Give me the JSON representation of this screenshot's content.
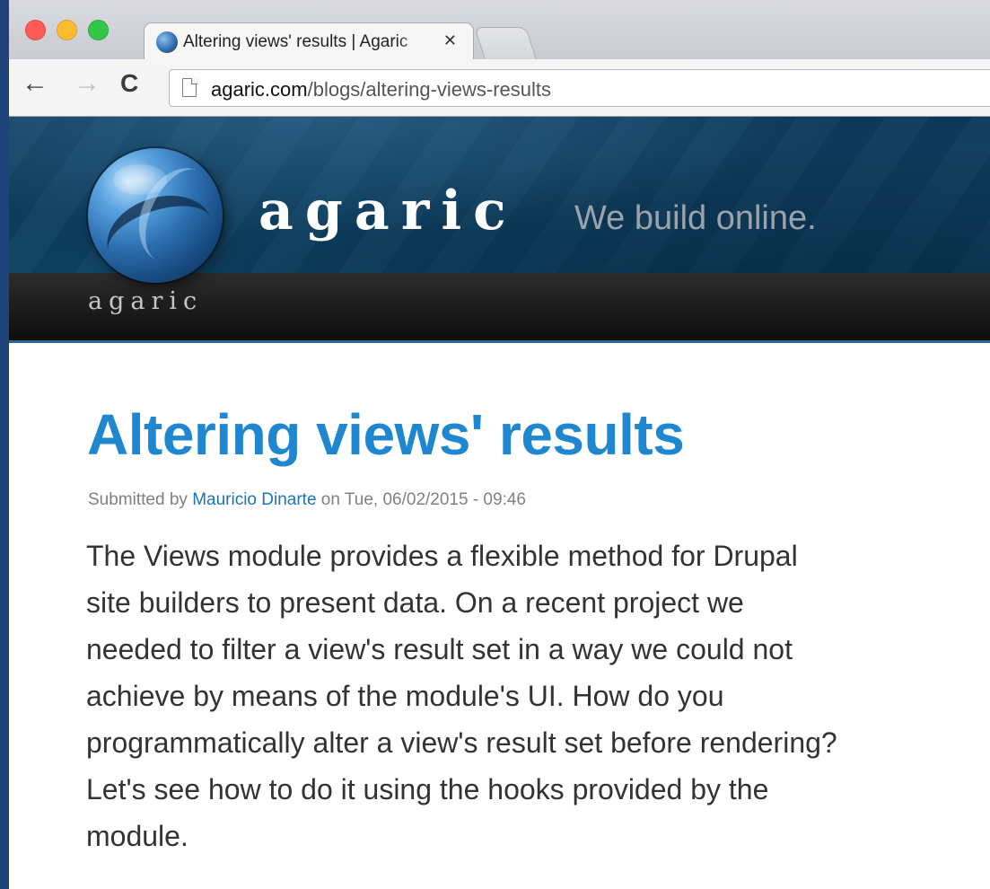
{
  "browser": {
    "tab": {
      "title": "Altering views' results | Agaric",
      "close_glyph": "✕"
    },
    "toolbar": {
      "back_glyph": "←",
      "forward_glyph": "→",
      "reload_glyph": "C"
    },
    "url": {
      "host": "agaric.com",
      "path": "/blogs/altering-views-results"
    },
    "icons": [
      "close-icon",
      "back-arrow-icon",
      "forward-arrow-icon",
      "reload-icon",
      "page-icon"
    ]
  },
  "site": {
    "brand": "agaric",
    "tagline": "We build online.",
    "logo_text": "agaric",
    "colors": {
      "header": "#0e3a5b",
      "navbar": "#111111",
      "accent": "#1f87cf"
    }
  },
  "article": {
    "title": "Altering views' results",
    "meta": {
      "prefix": "Submitted by",
      "author": "Mauricio Dinarte",
      "date_text": "on Tue, 06/02/2015 - 09:46"
    },
    "body_lines": [
      "The Views module provides a flexible method for Drupal",
      "site builders to present data. On a recent project we",
      "needed to filter a view's result set in a way we could not",
      "achieve by means of the module's UI. How do you",
      "programmatically alter a view's result set before rendering?",
      "Let's see how to do it using the hooks provided by the",
      "module."
    ]
  }
}
